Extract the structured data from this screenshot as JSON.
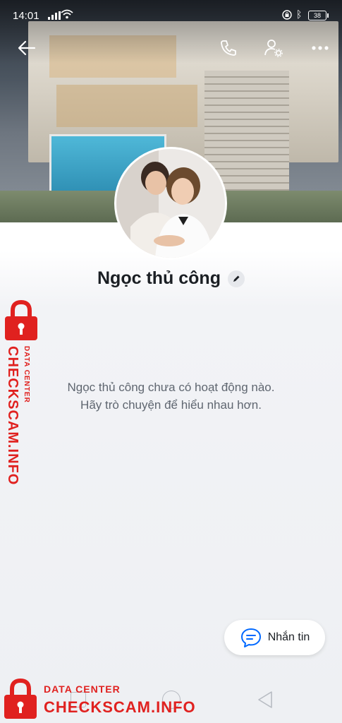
{
  "status_bar": {
    "time": "14:01",
    "battery": "38"
  },
  "profile": {
    "name": "Ngọc thủ công"
  },
  "empty_state": {
    "line1": "Ngọc thủ công chưa có hoạt động nào.",
    "line2": "Hãy trò chuyện để hiểu nhau hơn."
  },
  "actions": {
    "message_label": "Nhắn tin"
  },
  "watermark": {
    "side_main": "CHECKSCAM.INFO",
    "side_sub": "DATA CENTER",
    "bottom_sub": "DATA CENTER",
    "bottom_main": "CHECKSCAM.INFO",
    "color": "#e0211f"
  },
  "colors": {
    "accent_blue": "#0068ff",
    "text_dark": "#1b1f24",
    "text_muted": "#5f6670"
  }
}
